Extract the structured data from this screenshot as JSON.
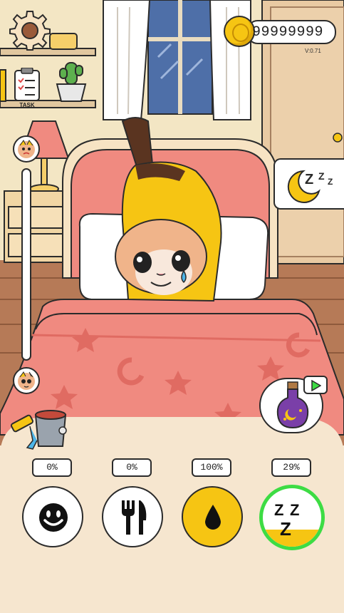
{
  "hud": {
    "coins": "99999999",
    "version": "V:0.71",
    "task_label": "TASK"
  },
  "stats": [
    {
      "id": "fun",
      "percent": "0%",
      "icon": "smiley-icon"
    },
    {
      "id": "food",
      "percent": "0%",
      "icon": "fork-knife-icon"
    },
    {
      "id": "water",
      "percent": "100%",
      "icon": "water-drop-icon"
    },
    {
      "id": "sleep",
      "percent": "29%",
      "icon": "zzz-icon",
      "level": 0.29,
      "selected": true
    }
  ],
  "colors": {
    "wall": "#f3e6c4",
    "floor": "#b67a57",
    "bed_pink": "#f08a80",
    "coin_gold": "#f6c513",
    "selected_ring": "#3ddc44",
    "water_bg": "#f6c513",
    "panel": "#f6e6cf"
  }
}
